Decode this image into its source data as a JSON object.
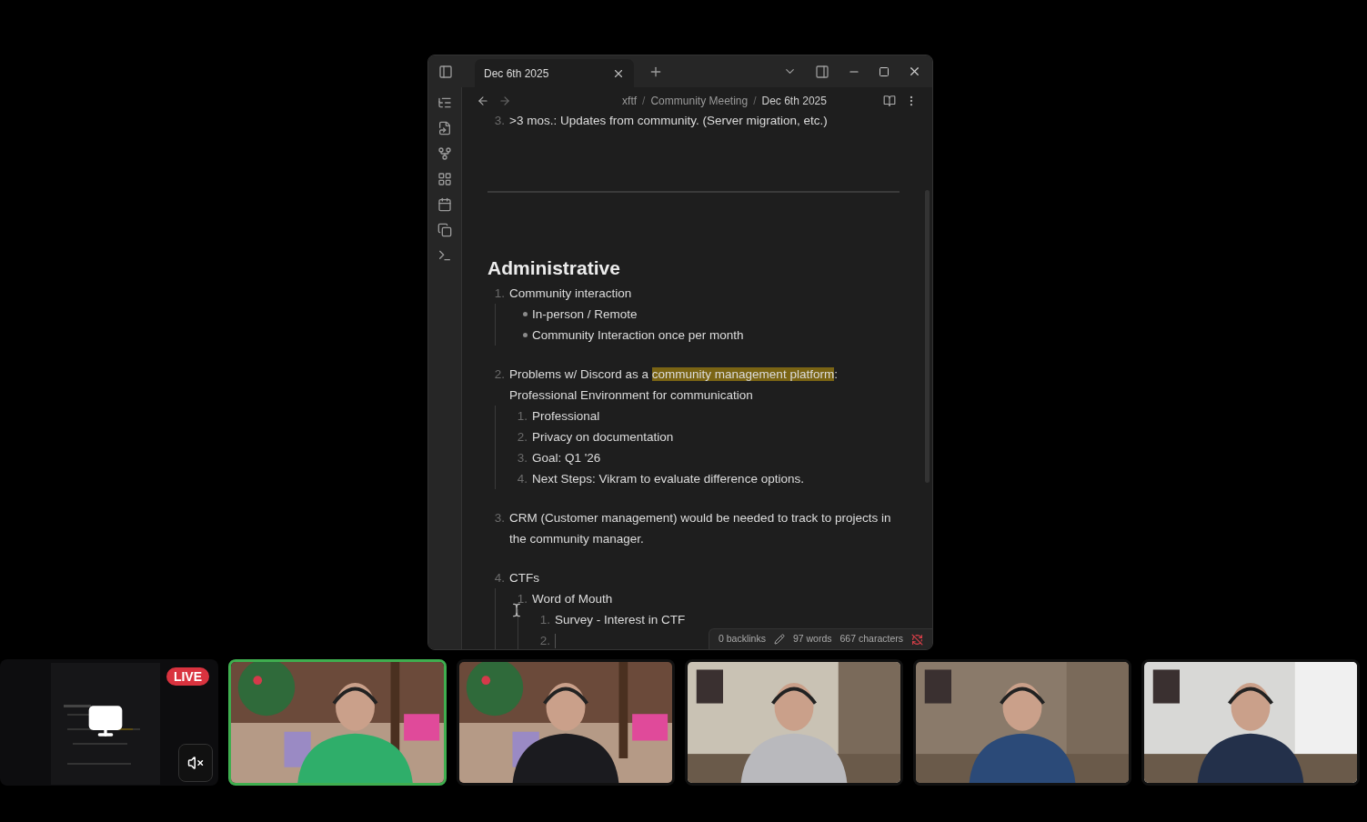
{
  "tab": {
    "title": "Dec 6th 2025",
    "selected": true
  },
  "breadcrumb": {
    "separator": "/",
    "items": [
      "xftf",
      "Community Meeting",
      "Dec 6th 2025"
    ]
  },
  "note": {
    "top_item": {
      "number": "3.",
      "text": ">3 mos.: Updates from community. (Server migration, etc.)"
    },
    "heading": "Administrative",
    "items": [
      {
        "kind": "numbered",
        "number": "1.",
        "parts": [
          {
            "text": "Community interaction",
            "highlighted": false
          }
        ],
        "children": [
          {
            "kind": "bullet",
            "parts": [
              {
                "text": "In-person / Remote",
                "highlighted": false
              }
            ]
          },
          {
            "kind": "bullet",
            "parts": [
              {
                "text": "Community Interaction once per month",
                "highlighted": false
              }
            ]
          }
        ]
      },
      {
        "kind": "numbered",
        "number": "2.",
        "parts": [
          {
            "text": "Problems w/ Discord as a ",
            "highlighted": false
          },
          {
            "text": "community management platform",
            "highlighted": true
          },
          {
            "text": ": Professional Environment for communication",
            "highlighted": false
          }
        ],
        "children": [
          {
            "kind": "numbered",
            "number": "1.",
            "parts": [
              {
                "text": "Professional",
                "highlighted": false
              }
            ]
          },
          {
            "kind": "numbered",
            "number": "2.",
            "parts": [
              {
                "text": "Privacy on documentation",
                "highlighted": false
              }
            ]
          },
          {
            "kind": "numbered",
            "number": "3.",
            "parts": [
              {
                "text": "Goal: Q1 '26",
                "highlighted": false
              }
            ]
          },
          {
            "kind": "numbered",
            "number": "4.",
            "parts": [
              {
                "text": "Next Steps: Vikram to evaluate difference options.",
                "highlighted": false
              }
            ]
          }
        ]
      },
      {
        "kind": "numbered",
        "number": "3.",
        "parts": [
          {
            "text": "CRM (Customer management) would be needed to track to projects in the community manager.",
            "highlighted": false
          }
        ]
      },
      {
        "kind": "numbered",
        "number": "4.",
        "parts": [
          {
            "text": "CTFs",
            "highlighted": false
          }
        ],
        "children": [
          {
            "kind": "numbered",
            "number": "1.",
            "parts": [
              {
                "text": "Word of Mouth",
                "highlighted": false
              }
            ],
            "children": [
              {
                "kind": "numbered",
                "number": "1.",
                "parts": [
                  {
                    "text": "Survey - Interest in CTF",
                    "highlighted": false
                  }
                ]
              },
              {
                "kind": "numbered",
                "number": "2."
              }
            ]
          }
        ]
      }
    ]
  },
  "status_bar": {
    "backlinks": "0 backlinks",
    "words": "97 words",
    "characters": "667 characters",
    "sync_error": true
  },
  "tiles": [
    {
      "kind": "screen_share",
      "badge": "LIVE",
      "muted": true,
      "selected": false
    },
    {
      "kind": "picture",
      "selected": true
    },
    {
      "kind": "picture",
      "selected": false
    },
    {
      "kind": "picture",
      "selected": false
    },
    {
      "kind": "picture",
      "selected": false
    },
    {
      "kind": "picture",
      "selected": false
    }
  ]
}
